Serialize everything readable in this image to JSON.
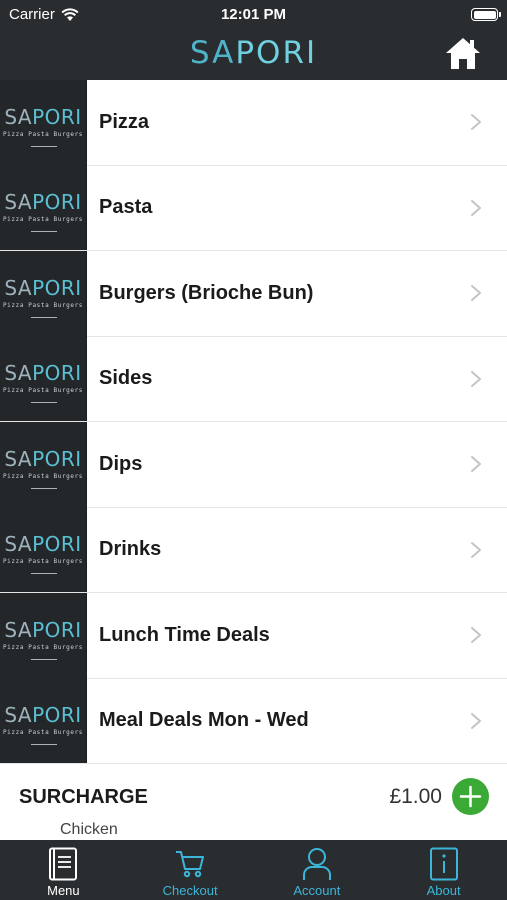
{
  "status_bar": {
    "carrier": "Carrier",
    "time": "12:01 PM"
  },
  "nav": {
    "brand_part1": "SA",
    "brand_part2": "PORI"
  },
  "thumb": {
    "logo_part1": "SA",
    "logo_part2": "PORI",
    "tagline": "Pizza Pasta Burgers"
  },
  "menu": {
    "items": [
      {
        "label": "Pizza"
      },
      {
        "label": "Pasta"
      },
      {
        "label": "Burgers (Brioche Bun)"
      },
      {
        "label": "Sides"
      },
      {
        "label": "Dips"
      },
      {
        "label": "Drinks"
      },
      {
        "label": "Lunch Time Deals"
      },
      {
        "label": "Meal Deals Mon - Wed"
      }
    ]
  },
  "surcharge": {
    "title": "SURCHARGE",
    "price": "£1.00",
    "subtitle": "Chicken"
  },
  "tabs": [
    {
      "label": "Menu",
      "icon": "menu-book-icon",
      "active": true
    },
    {
      "label": "Checkout",
      "icon": "cart-icon",
      "active": false
    },
    {
      "label": "Account",
      "icon": "account-icon",
      "active": false
    },
    {
      "label": "About",
      "icon": "info-icon",
      "active": false
    }
  ],
  "colors": {
    "bar_bg": "#2a2d30",
    "accent": "#3bb6d8",
    "add_green": "#3aa935"
  }
}
